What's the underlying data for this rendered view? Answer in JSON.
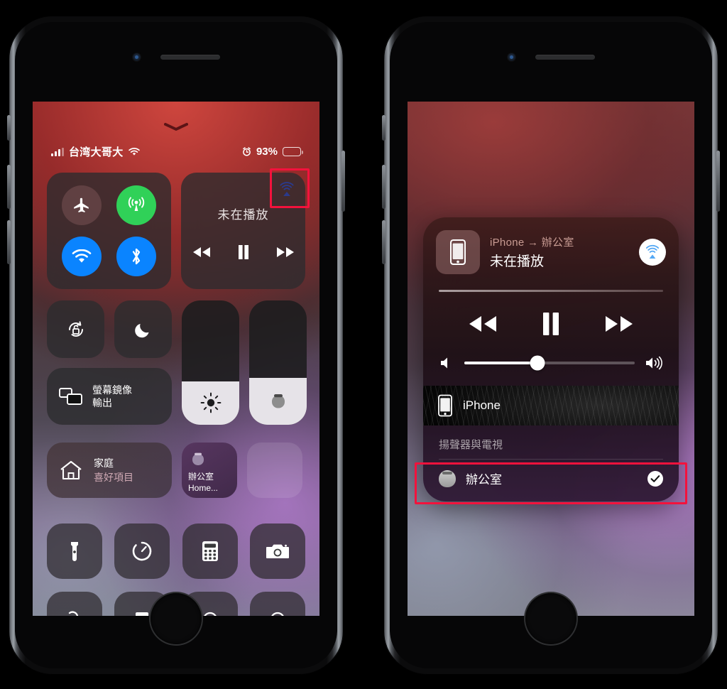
{
  "left_phone": {
    "status_bar": {
      "carrier": "台湾大哥大",
      "signal_icon": "cellular-bars-icon",
      "wifi_icon": "wifi-icon",
      "alarm_icon": "alarm-clock-icon",
      "battery_percent": "93%",
      "battery_icon": "battery-icon",
      "battery_level": 93
    },
    "handle_icon": "chevron-down-handle-icon",
    "connectivity": {
      "airplane": {
        "label_icon": "airplane-icon",
        "state": "off"
      },
      "cellular": {
        "label_icon": "cellular-antenna-icon",
        "state": "on",
        "color": "#30d158"
      },
      "wifi": {
        "label_icon": "wifi-icon",
        "state": "on",
        "color": "#0a84ff"
      },
      "bluetooth": {
        "label_icon": "bluetooth-icon",
        "state": "on",
        "color": "#0a84ff"
      }
    },
    "media": {
      "title": "未在播放",
      "airplay_icon": "airplay-audio-icon",
      "rewind_icon": "rewind-icon",
      "pause_icon": "pause-icon",
      "forward_icon": "fast-forward-icon",
      "highlight_color": "#f3123c"
    },
    "toggles": {
      "rotation_lock_icon": "rotation-lock-icon",
      "do_not_disturb_icon": "moon-icon"
    },
    "screen_mirroring": {
      "icon": "screen-mirroring-icon",
      "line1": "螢幕鏡像",
      "line2": "輸出"
    },
    "sliders": {
      "brightness": {
        "icon": "brightness-sun-icon",
        "value": 35
      },
      "volume": {
        "icon": "homepod-icon",
        "value": 38
      }
    },
    "home": {
      "icon": "house-icon",
      "line1": "家庭",
      "line2": "喜好項目"
    },
    "accessory": {
      "icon": "homepod-icon",
      "name": "辦公室",
      "sub": "Home..."
    },
    "apps_row1": [
      {
        "icon": "flashlight-icon",
        "name": "flashlight"
      },
      {
        "icon": "timer-icon",
        "name": "timer"
      },
      {
        "icon": "calculator-icon",
        "name": "calculator"
      },
      {
        "icon": "camera-icon",
        "name": "camera"
      }
    ],
    "apps_row2": [
      {
        "icon": "hearing-icon",
        "name": "hearing"
      },
      {
        "icon": "notes-icon",
        "name": "notes"
      },
      {
        "icon": "scan-icon",
        "name": "qr-scan"
      },
      {
        "icon": "voice-memo-icon",
        "name": "voice-memo"
      }
    ]
  },
  "right_phone": {
    "now_playing": {
      "art_icon": "iphone-device-icon",
      "route": "iPhone → 辦公室",
      "state": "未在播放",
      "airplay_icon": "airplay-audio-icon"
    },
    "transport": {
      "rewind_icon": "rewind-icon",
      "pause_icon": "pause-icon",
      "forward_icon": "fast-forward-icon"
    },
    "volume": {
      "low_icon": "speaker-low-icon",
      "high_icon": "speaker-high-icon",
      "value": 43
    },
    "current_device": {
      "icon": "iphone-device-icon",
      "name": "iPhone",
      "highlight_color": "#f3123c"
    },
    "speakers_section": {
      "title": "揚聲器與電視",
      "devices": [
        {
          "icon": "homepod-icon",
          "name": "辦公室",
          "selected": true,
          "check_icon": "checkmark-icon"
        }
      ]
    }
  }
}
